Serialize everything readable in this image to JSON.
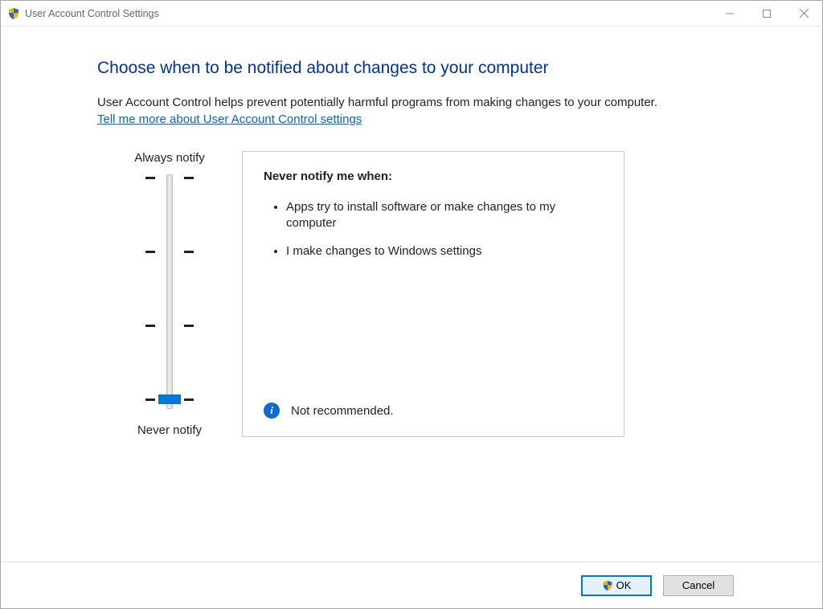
{
  "window": {
    "title": "User Account Control Settings"
  },
  "heading": "Choose when to be notified about changes to your computer",
  "description": "User Account Control helps prevent potentially harmful programs from making changes to your computer.",
  "help_link": "Tell me more about User Account Control settings",
  "slider": {
    "top_label": "Always notify",
    "bottom_label": "Never notify",
    "levels": 4,
    "current_level_index": 3
  },
  "panel": {
    "heading": "Never notify me when:",
    "bullets": [
      "Apps try to install software or make changes to my computer",
      "I make changes to Windows settings"
    ],
    "status_text": "Not recommended."
  },
  "footer": {
    "ok_label": "OK",
    "cancel_label": "Cancel"
  }
}
